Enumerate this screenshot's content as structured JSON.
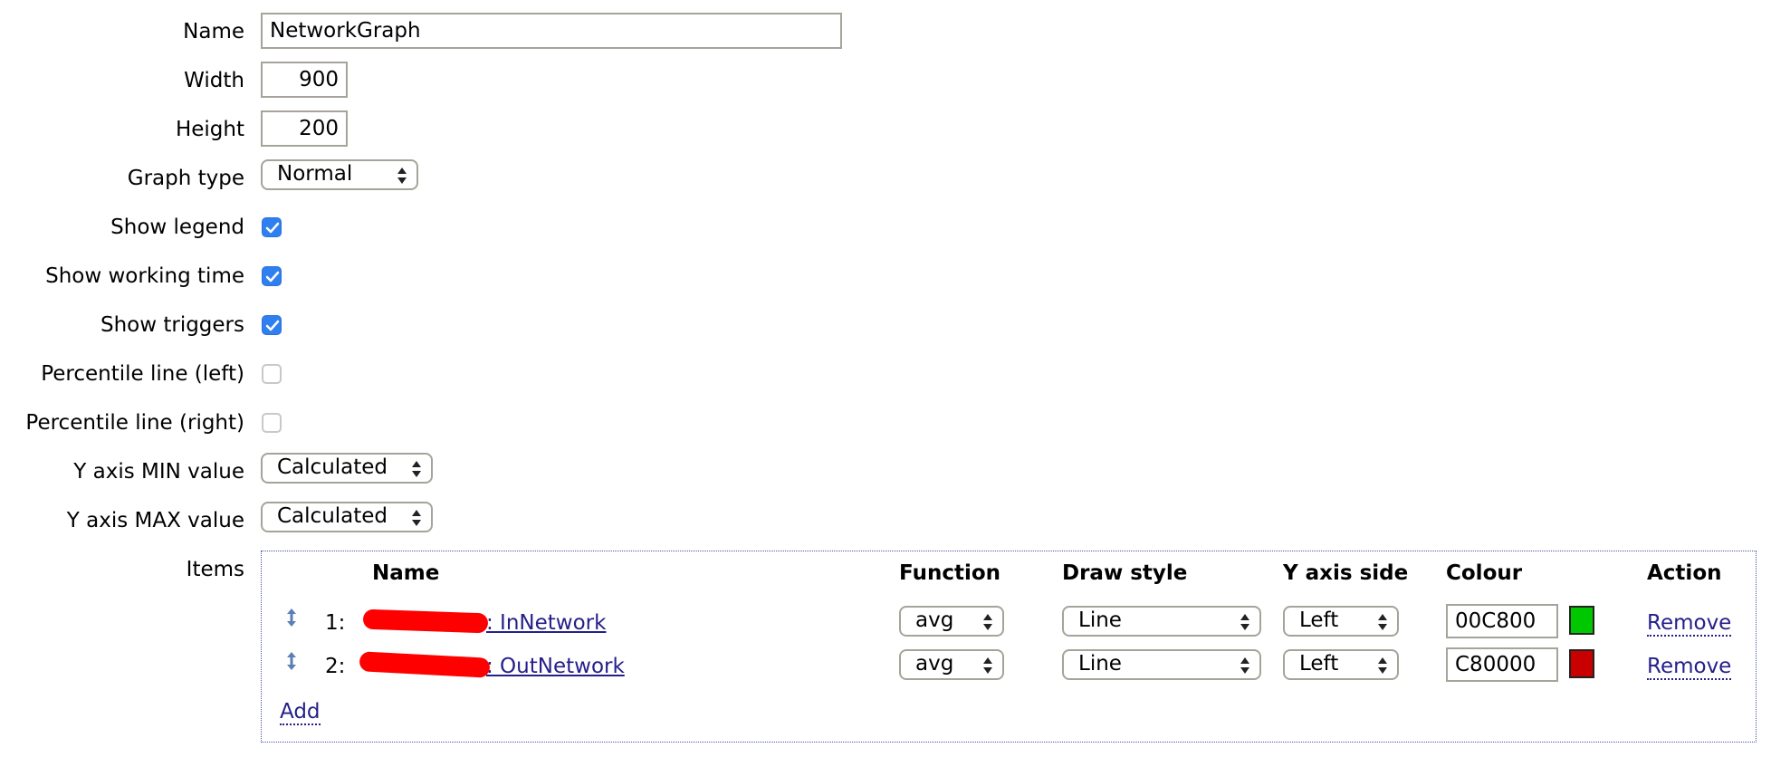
{
  "form": {
    "name": {
      "label": "Name",
      "value": "NetworkGraph"
    },
    "width": {
      "label": "Width",
      "value": "900"
    },
    "height": {
      "label": "Height",
      "value": "200"
    },
    "graph_type": {
      "label": "Graph type",
      "value": "Normal"
    },
    "show_legend": {
      "label": "Show legend",
      "checked": true
    },
    "show_working_time": {
      "label": "Show working time",
      "checked": true
    },
    "show_triggers": {
      "label": "Show triggers",
      "checked": true
    },
    "percentile_left": {
      "label": "Percentile line (left)",
      "checked": false
    },
    "percentile_right": {
      "label": "Percentile line (right)",
      "checked": false
    },
    "y_min": {
      "label": "Y axis MIN value",
      "value": "Calculated"
    },
    "y_max": {
      "label": "Y axis MAX value",
      "value": "Calculated"
    },
    "items_label": "Items"
  },
  "items": {
    "headers": {
      "name": "Name",
      "function": "Function",
      "draw_style": "Draw style",
      "y_axis_side": "Y axis side",
      "colour": "Colour",
      "action": "Action"
    },
    "rows": [
      {
        "index": "1:",
        "name_visible": ": InNetwork",
        "function": "avg",
        "draw_style": "Line",
        "y_axis_side": "Left",
        "colour": "00C800",
        "colour_hex": "#00C800",
        "action": "Remove"
      },
      {
        "index": "2:",
        "name_visible": ": OutNetwork",
        "function": "avg",
        "draw_style": "Line",
        "y_axis_side": "Left",
        "colour": "C80000",
        "colour_hex": "#C80000",
        "action": "Remove"
      }
    ],
    "add_label": "Add"
  },
  "colors": {
    "checkbox_on": "#2f7ff0",
    "link": "#241f8a",
    "redaction": "#ff0000",
    "border": "#a6a39a"
  }
}
